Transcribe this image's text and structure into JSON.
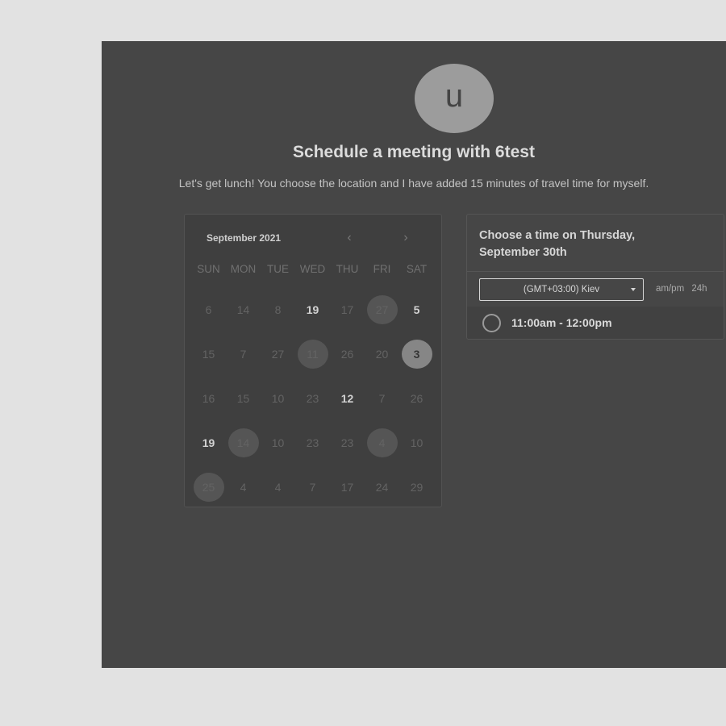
{
  "host": {
    "avatar_letter": "u"
  },
  "header": {
    "title": "Schedule a meeting with 6test",
    "description": "Let's get lunch! You choose the location and I have added 15 minutes of travel time for myself."
  },
  "calendar": {
    "month_label": "September 2021",
    "prev_icon": "‹",
    "next_icon": "›",
    "weekdays": [
      "SUN",
      "MON",
      "TUE",
      "WED",
      "THU",
      "FRI",
      "SAT"
    ],
    "days": [
      {
        "label": "6",
        "state": "dim"
      },
      {
        "label": "14",
        "state": "dim"
      },
      {
        "label": "8",
        "state": "dim"
      },
      {
        "label": "19",
        "state": "available"
      },
      {
        "label": "17",
        "state": "dim"
      },
      {
        "label": "27",
        "state": "marked"
      },
      {
        "label": "5",
        "state": "available"
      },
      {
        "label": "15",
        "state": "dim"
      },
      {
        "label": "7",
        "state": "dim"
      },
      {
        "label": "27",
        "state": "dim"
      },
      {
        "label": "11",
        "state": "marked"
      },
      {
        "label": "26",
        "state": "dim"
      },
      {
        "label": "20",
        "state": "dim"
      },
      {
        "label": "3",
        "state": "selected"
      },
      {
        "label": "16",
        "state": "dim"
      },
      {
        "label": "15",
        "state": "dim"
      },
      {
        "label": "10",
        "state": "dim"
      },
      {
        "label": "23",
        "state": "dim"
      },
      {
        "label": "12",
        "state": "available"
      },
      {
        "label": "7",
        "state": "dim"
      },
      {
        "label": "26",
        "state": "dim"
      },
      {
        "label": "19",
        "state": "available"
      },
      {
        "label": "14",
        "state": "marked"
      },
      {
        "label": "10",
        "state": "dim"
      },
      {
        "label": "23",
        "state": "dim"
      },
      {
        "label": "23",
        "state": "dim"
      },
      {
        "label": "4",
        "state": "marked"
      },
      {
        "label": "10",
        "state": "dim"
      },
      {
        "label": "25",
        "state": "marked"
      },
      {
        "label": "4",
        "state": "dim"
      },
      {
        "label": "4",
        "state": "dim"
      },
      {
        "label": "7",
        "state": "dim"
      },
      {
        "label": "17",
        "state": "dim"
      },
      {
        "label": "24",
        "state": "dim"
      },
      {
        "label": "29",
        "state": "dim"
      }
    ]
  },
  "time_panel": {
    "heading": "Choose a time on Thursday, September 30th",
    "timezone": "(GMT+03:00) Kiev",
    "format_options": [
      "am/pm",
      "24h"
    ],
    "slots": [
      {
        "label": "11:00am - 12:00pm"
      }
    ]
  }
}
